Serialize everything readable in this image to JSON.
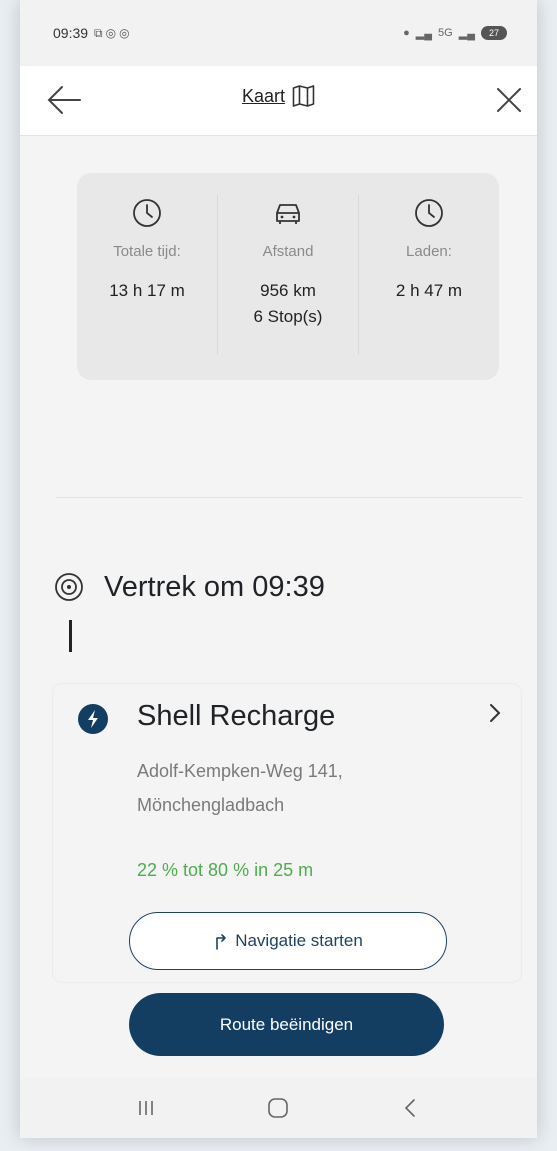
{
  "status_bar": {
    "time": "09:39",
    "notification_icons": [
      "screenshot-icon",
      "whatsapp-icon",
      "whatsapp-business-icon"
    ],
    "sim_label": "5G",
    "battery": "27"
  },
  "header": {
    "map_label": "Kaart"
  },
  "summary": {
    "total_time_label": "Totale tijd:",
    "total_time_value": "13 h 17 m",
    "distance_label": "Afstand",
    "distance_value": "956 km",
    "stops_value": "6 Stop(s)",
    "charging_label": "Laden:",
    "charging_value": "2 h 47 m"
  },
  "departure": {
    "title": "Vertrek om 09:39"
  },
  "stop": {
    "name": "Shell Recharge",
    "address_line1": "Adolf-Kempken-Weg 141,",
    "address_line2": "Mönchengladbach",
    "charge_info": "22 % tot 80 % in 25 m",
    "nav_button": "Navigatie starten"
  },
  "end_route_button": "Route beëindigen",
  "colors": {
    "primary": "#133e62",
    "charge_green": "#4cae4c",
    "summary_bg": "#e8e8e8"
  }
}
